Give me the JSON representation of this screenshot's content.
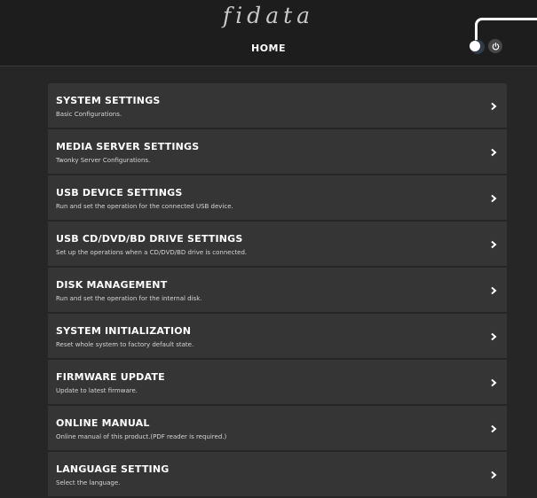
{
  "header": {
    "logo_text": "fidata",
    "page_title": "HOME",
    "help_label": "?",
    "power_icon": "power-icon"
  },
  "menu": {
    "items": [
      {
        "title": "SYSTEM SETTINGS",
        "description": "Basic Configurations."
      },
      {
        "title": "MEDIA SERVER SETTINGS",
        "description": "Twonky Server Configurations."
      },
      {
        "title": "USB DEVICE SETTINGS",
        "description": "Run and set the operation for the connected USB device."
      },
      {
        "title": "USB CD/DVD/BD DRIVE SETTINGS",
        "description": "Set up the operations when a CD/DVD/BD drive is connected."
      },
      {
        "title": "DISK MANAGEMENT",
        "description": "Run and set the operation for the internal disk."
      },
      {
        "title": "SYSTEM INITIALIZATION",
        "description": "Reset whole system to factory default state."
      },
      {
        "title": "FIRMWARE UPDATE",
        "description": "Update to latest firmware."
      },
      {
        "title": "ONLINE MANUAL",
        "description": "Online manual of this product.(PDF reader is required.)"
      },
      {
        "title": "LANGUAGE SETTING",
        "description": "Select the language."
      }
    ],
    "chevron_icon": "chevron-right-icon"
  },
  "colors": {
    "background": "#262626",
    "header_background": "#1d1d1d",
    "item_background": "#353535"
  }
}
